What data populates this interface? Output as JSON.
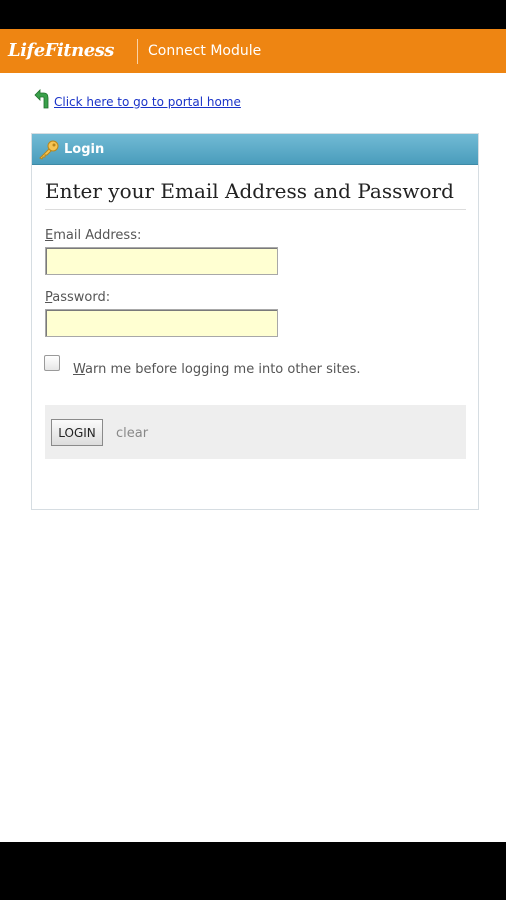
{
  "header": {
    "brand": "LifeFitness",
    "module_title": "Connect Module",
    "brand_color": "#ee8512"
  },
  "portal_link": {
    "text": "Click here to go to portal home",
    "icon": "back-arrow-icon"
  },
  "login_panel": {
    "title": "Login",
    "title_icon": "key-icon",
    "heading": "Enter your Email Address and Password",
    "email": {
      "label_access_key": "E",
      "label_rest": "mail Address:",
      "value": ""
    },
    "password": {
      "label_access_key": "P",
      "label_rest": "assword:",
      "value": ""
    },
    "warn_checkbox": {
      "checked": false,
      "label_access_key": "W",
      "label_rest": "arn me before logging me into other sites."
    },
    "login_button": "LOGIN",
    "clear_link": "clear"
  }
}
